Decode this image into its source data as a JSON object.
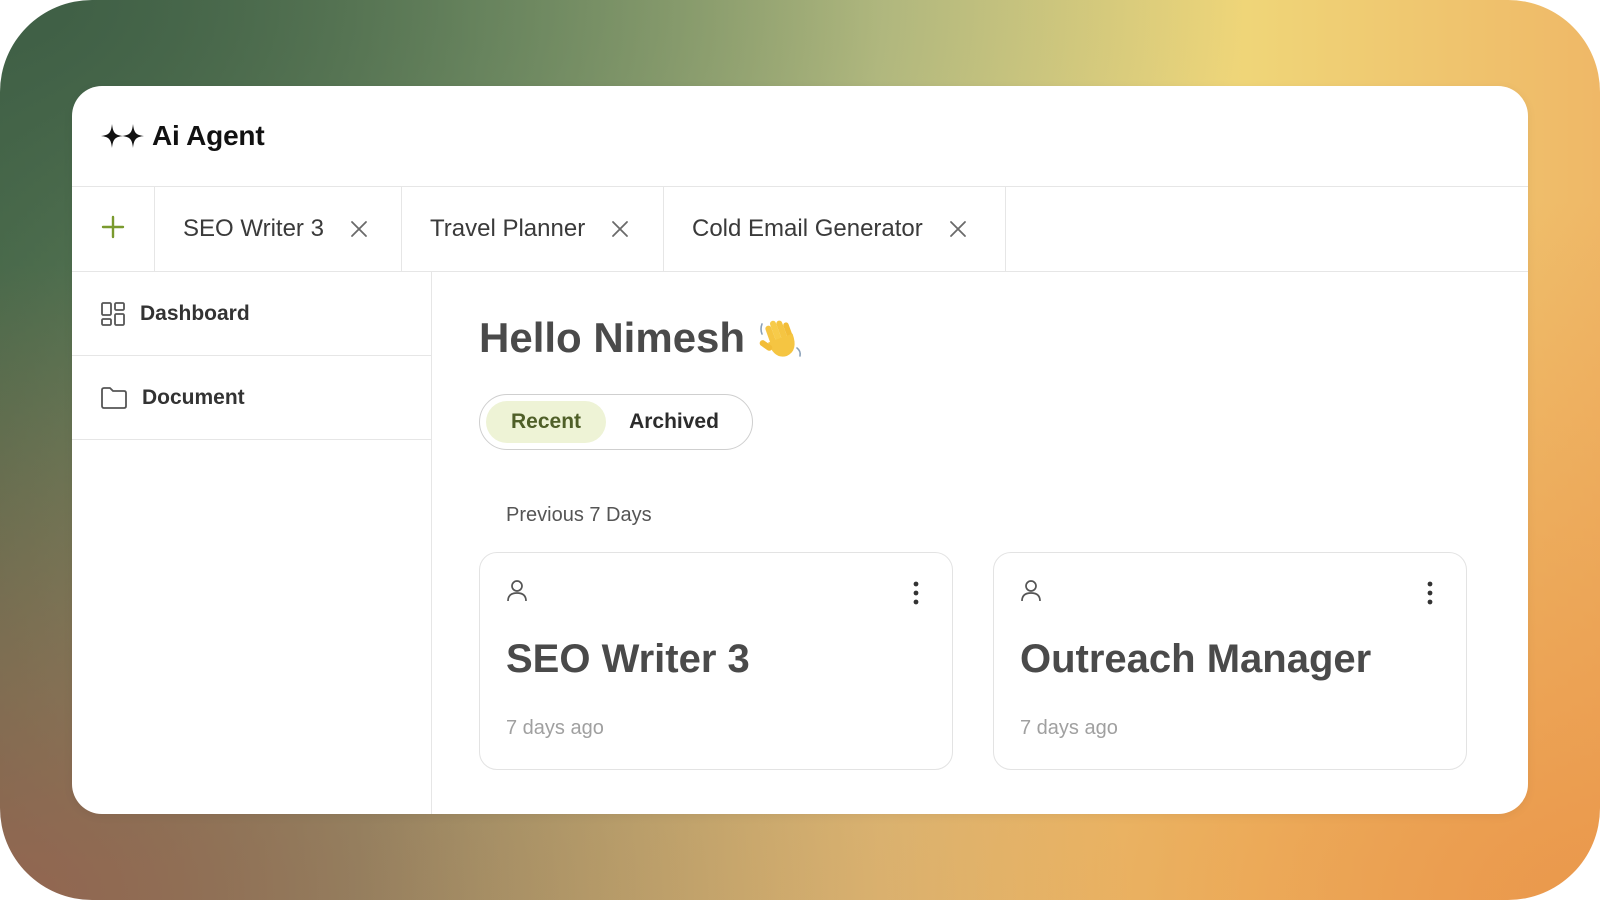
{
  "app": {
    "title": "Ai Agent",
    "logo_icon": "sparkles-icon"
  },
  "tabs": {
    "add_icon": "plus-icon",
    "items": [
      {
        "label": "SEO Writer 3",
        "close_icon": "close-icon"
      },
      {
        "label": "Travel Planner",
        "close_icon": "close-icon"
      },
      {
        "label": "Cold Email Generator",
        "close_icon": "close-icon"
      }
    ]
  },
  "sidebar": {
    "items": [
      {
        "label": "Dashboard",
        "icon": "dashboard-grid-icon"
      },
      {
        "label": "Document",
        "icon": "folder-icon"
      }
    ]
  },
  "main": {
    "greeting": "Hello Nimesh",
    "greeting_emoji": "👋",
    "toggle": {
      "active": "Recent",
      "inactive": "Archived"
    },
    "section_label": "Previous 7 Days",
    "cards": [
      {
        "title": "SEO Writer 3",
        "time": "7 days ago",
        "icon": "user-icon",
        "menu_icon": "more-vertical-icon"
      },
      {
        "title": "Outreach Manager",
        "time": "7 days ago",
        "icon": "user-icon",
        "menu_icon": "more-vertical-icon"
      }
    ]
  },
  "colors": {
    "accent_green": "#7a9a2e",
    "active_toggle_bg": "#eef3d6",
    "active_toggle_text": "#4f5f28"
  }
}
